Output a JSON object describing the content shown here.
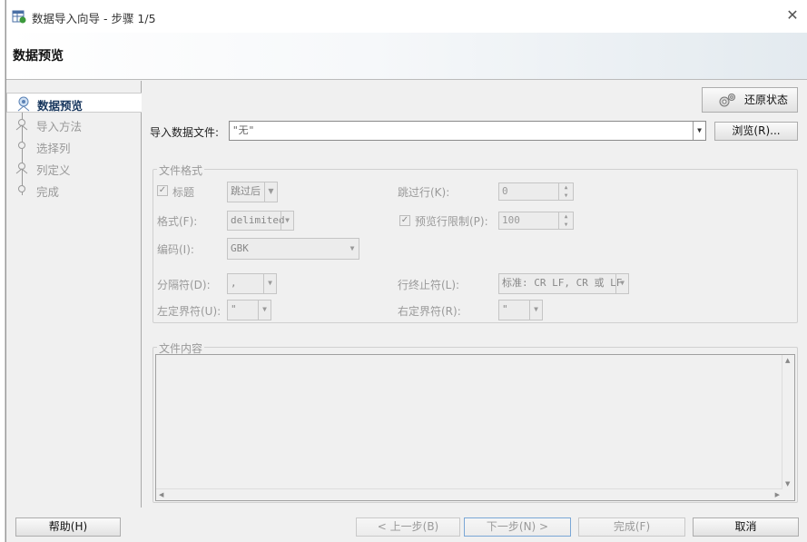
{
  "window": {
    "title": "数据导入向导 - 步骤 1/5",
    "close_glyph": "✕"
  },
  "header": {
    "title": "数据预览"
  },
  "nav": {
    "items": [
      {
        "label": "数据预览",
        "active": true
      },
      {
        "label": "导入方法",
        "active": false
      },
      {
        "label": "选择列",
        "active": false
      },
      {
        "label": "列定义",
        "active": false
      },
      {
        "label": "完成",
        "active": false
      }
    ]
  },
  "toolbar": {
    "restore_label": "还原状态"
  },
  "import_file": {
    "label": "导入数据文件:",
    "value": "\"无\"",
    "browse_label": "浏览(R)..."
  },
  "file_format": {
    "title": "文件格式",
    "header_checkbox_label": "标题",
    "header_checked": true,
    "header_mode": "跳过后",
    "skip_rows_label": "跳过行(K):",
    "skip_rows_value": "0",
    "format_label": "格式(F):",
    "format_value": "delimited",
    "preview_limit_label": "预览行限制(P):",
    "preview_limit_checked": true,
    "preview_limit_value": "100",
    "encoding_label": "编码(I):",
    "encoding_value": "GBK",
    "delimiter_label": "分隔符(D):",
    "delimiter_value": ",",
    "line_terminator_label": "行终止符(L):",
    "line_terminator_value": "标准: CR LF, CR 或 LF",
    "left_enclosure_label": "左定界符(U):",
    "left_enclosure_value": "\"",
    "right_enclosure_label": "右定界符(R):",
    "right_enclosure_value": "\""
  },
  "file_content": {
    "title": "文件内容"
  },
  "footer": {
    "help_label": "帮助(H)",
    "back_label": "< 上一步(B)",
    "next_label": "下一步(N) >",
    "finish_label": "完成(F)",
    "cancel_label": "取消"
  },
  "colors": {
    "active_nav_text": "#17365d",
    "disabled_text": "#9a9a9a",
    "header_gradient_end": "#e3eaef"
  }
}
